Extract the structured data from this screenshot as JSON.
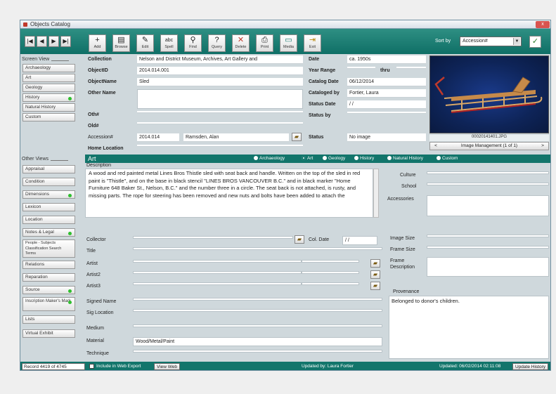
{
  "window": {
    "title": "Objects Catalog",
    "close_label": "x"
  },
  "toolbar": {
    "nav": [
      "|◀",
      "◀",
      "▶",
      "▶|"
    ],
    "buttons": [
      {
        "label": "Add",
        "glyph": "+"
      },
      {
        "label": "Browse",
        "glyph": "▤"
      },
      {
        "label": "Edit",
        "glyph": "✎"
      },
      {
        "label": "Spell",
        "glyph": "abc"
      },
      {
        "label": "Find",
        "glyph": "⚲"
      },
      {
        "label": "Query",
        "glyph": "?"
      },
      {
        "label": "Delete",
        "glyph": "✕"
      },
      {
        "label": "Print",
        "glyph": "⎙"
      },
      {
        "label": "Media",
        "glyph": "▭"
      },
      {
        "label": "Exit",
        "glyph": "⇥"
      }
    ],
    "sort_label": "Sort by",
    "sort_value": "Accession#",
    "sort_arrow": "▼",
    "apply_glyph": "✓"
  },
  "screen_view": {
    "heading": "Screen View",
    "items": [
      "Archaeology",
      "Art",
      "Geology",
      "History",
      "Natural History",
      "Custom"
    ],
    "dot_items": [
      false,
      false,
      false,
      true,
      false,
      false
    ]
  },
  "other_views": {
    "heading": "Other Views",
    "items": [
      "Appraisal",
      "Condition",
      "Dimensions",
      "Lexicon",
      "Location",
      "Notes & Legal",
      "People - Subjects Classification Search Terms",
      "Relations",
      "Reparation",
      "Source",
      "Inscription Maker's Mark",
      "Lists",
      "Virtual Exhibit"
    ],
    "dot_items": [
      false,
      false,
      true,
      false,
      false,
      true,
      false,
      false,
      false,
      true,
      true,
      false,
      false
    ]
  },
  "record": {
    "collection": {
      "label": "Collection",
      "value": "Nelson and District Museum, Archives, Art Gallery and"
    },
    "objectid": {
      "label": "ObjectID",
      "value": "2014.014.001"
    },
    "objectname": {
      "label": "ObjectName",
      "value": "Sled"
    },
    "othername": {
      "label": "Other Name",
      "value": ""
    },
    "othno": {
      "label": "Oth#",
      "value": ""
    },
    "old": {
      "label": "Old#",
      "value": ""
    },
    "accession": {
      "label": "Accession#",
      "value": "2014.014",
      "person": "Ramsden, Alan"
    },
    "homelocation": {
      "label": "Home Location",
      "value": ""
    },
    "date": {
      "label": "Date",
      "value": "ca. 1950s"
    },
    "yearrange": {
      "label": "Year Range",
      "value": "",
      "thru": "thru"
    },
    "catalogdate": {
      "label": "Catalog Date",
      "value": "06/12/2014"
    },
    "catalogedby": {
      "label": "Cataloged by",
      "value": "Fortier, Laura"
    },
    "statusdate": {
      "label": "Status Date",
      "value": "/ /"
    },
    "statusby": {
      "label": "Status by",
      "value": ""
    },
    "status": {
      "label": "Status",
      "value": "No image"
    }
  },
  "image": {
    "filename": "00020141401.JPG",
    "management_label": "Image Management (1 of 1)",
    "prev": "<",
    "next": ">"
  },
  "section": {
    "tab": "Art",
    "radios": [
      {
        "label": "Archaeology",
        "on": false
      },
      {
        "label": "Art",
        "on": true
      },
      {
        "label": "Geology",
        "on": false
      },
      {
        "label": "History",
        "on": false
      },
      {
        "label": "Natural History",
        "on": false
      },
      {
        "label": "Custom",
        "on": false
      }
    ]
  },
  "description": {
    "label": "Description",
    "text": "A wood and red painted metal Lines Bros Thistle sled with seat back and handle. Written on the top of the sled in red paint is \"Thistle\", and on the base in black stencil \"LINES BROS VANCOUVER B.C.\" and in black marker \"Home Furniture 648 Baker St., Nelson, B.C.\" and the number three in a circle. The seat back is not attached, is rusty, and missing parts. The rope for steering has been removed and new nuts and bolts have been added to attach the"
  },
  "right_fields": {
    "culture": {
      "label": "Culture",
      "value": ""
    },
    "school": {
      "label": "School",
      "value": ""
    },
    "accessories": {
      "label": "Accessories",
      "value": ""
    },
    "imagesize": {
      "label": "Image Size",
      "value": ""
    },
    "framesize": {
      "label": "Frame Size",
      "value": ""
    },
    "framedesc": {
      "label": "Frame Description",
      "value": ""
    },
    "provenance": {
      "label": "Provenance",
      "value": "Belonged to donor's children."
    }
  },
  "art_fields": {
    "collector": {
      "label": "Collector",
      "value": ""
    },
    "coldate": {
      "label": "Col. Date",
      "value": "/ /"
    },
    "title": {
      "label": "Title",
      "value": ""
    },
    "artist": {
      "label": "Artist",
      "value": ""
    },
    "artist2": {
      "label": "Artist2",
      "value": ""
    },
    "artist3": {
      "label": "Artist3",
      "value": ""
    },
    "signedname": {
      "label": "Signed Name",
      "value": ""
    },
    "siglocation": {
      "label": "Sig Location",
      "value": ""
    },
    "medium": {
      "label": "Medium",
      "value": ""
    },
    "material": {
      "label": "Material",
      "value": "Wood/Metal/Paint"
    },
    "technique": {
      "label": "Technique",
      "value": ""
    }
  },
  "status_bar": {
    "record": "Record 4419 of 4745",
    "include_label": "Include in Web Export",
    "view_web": "View Web",
    "updated_by": "Updated by: Laura Fortier",
    "updated": "Updated: 06/02/2014 02:11:08",
    "update_history": "Update History"
  },
  "colors": {
    "toolbar": "#12756b",
    "status_dot": "#2fbf2f"
  }
}
